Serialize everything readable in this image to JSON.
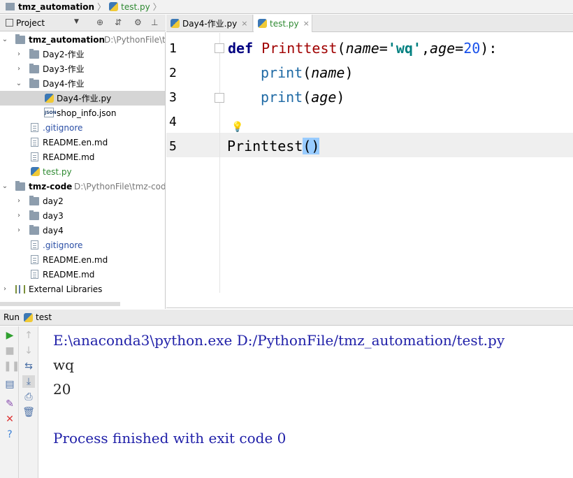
{
  "breadcrumb": {
    "project": "tmz_automation",
    "file": "test.py",
    "project_icon": "folder-icon",
    "file_icon": "python-file-icon"
  },
  "project_panel": {
    "title": "Project",
    "icons": [
      "settings-target-icon",
      "collapse-icon",
      "gear-icon",
      "hide-icon"
    ],
    "tree": [
      {
        "label": "tmz_automation",
        "path": "D:\\PythonFile\\tr",
        "kind": "root",
        "expanded": true
      },
      {
        "label": "Day2-作业",
        "kind": "folder",
        "expanded": false
      },
      {
        "label": "Day3-作业",
        "kind": "folder",
        "expanded": false
      },
      {
        "label": "Day4-作业",
        "kind": "folder",
        "expanded": true
      },
      {
        "label": "Day4-作业.py",
        "kind": "py",
        "selected": true
      },
      {
        "label": "shop_info.json",
        "kind": "json"
      },
      {
        "label": ".gitignore",
        "kind": "file",
        "color": "blue"
      },
      {
        "label": "README.en.md",
        "kind": "file"
      },
      {
        "label": "README.md",
        "kind": "file"
      },
      {
        "label": "test.py",
        "kind": "py",
        "color": "green"
      },
      {
        "label": "tmz-code",
        "path": "D:\\PythonFile\\tmz-code",
        "kind": "root",
        "expanded": true
      },
      {
        "label": "day2",
        "kind": "folder",
        "expanded": false
      },
      {
        "label": "day3",
        "kind": "folder",
        "expanded": false
      },
      {
        "label": "day4",
        "kind": "folder",
        "expanded": false
      },
      {
        "label": ".gitignore",
        "kind": "file",
        "color": "blue"
      },
      {
        "label": "README.en.md",
        "kind": "file"
      },
      {
        "label": "README.md",
        "kind": "file"
      },
      {
        "label": "External Libraries",
        "kind": "lib",
        "expanded": false
      }
    ]
  },
  "editor": {
    "tabs": [
      {
        "label": "Day4-作业.py",
        "active": false
      },
      {
        "label": "test.py",
        "active": true
      }
    ],
    "line_numbers": [
      "1",
      "2",
      "3",
      "4",
      "5"
    ],
    "code": {
      "l1_def": "def",
      "l1_name": "Printtest",
      "l1_open": "(",
      "l1_p1": "name",
      "l1_eq1": "=",
      "l1_str": "'wq'",
      "l1_comma": ",",
      "l1_p2": "age",
      "l1_eq2": "=",
      "l1_num": "20",
      "l1_close": "):",
      "l2_fn": "print",
      "l2_open": "(",
      "l2_arg": "name",
      "l2_close": ")",
      "l3_fn": "print",
      "l3_open": "(",
      "l3_arg": "age",
      "l3_close": ")",
      "l5_call": "Printtest",
      "l5_parens": "()"
    }
  },
  "run_panel": {
    "label": "Run",
    "config": "test",
    "console": [
      "E:\\anaconda3\\python.exe D:/PythonFile/tmz_automation/test.py",
      "wq",
      "20",
      "Process finished with exit code 0"
    ],
    "left_tools": [
      "run-icon",
      "stop-icon",
      "pause-icon",
      "layout-icon",
      "pin-icon",
      "close-icon",
      "help-icon"
    ],
    "right_tools": [
      "up-arrow-icon",
      "down-arrow-icon",
      "soft-wrap-icon",
      "scroll-to-end-icon",
      "print-icon",
      "trash-icon"
    ]
  }
}
